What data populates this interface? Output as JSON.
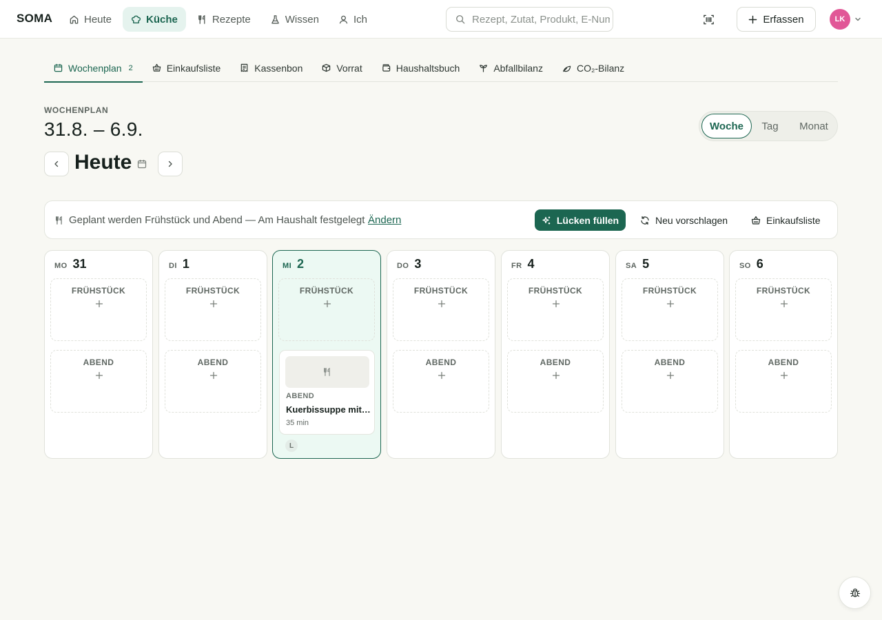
{
  "header": {
    "logo": "SOMA",
    "nav": [
      {
        "label": "Heute",
        "icon": "home-icon"
      },
      {
        "label": "Küche",
        "icon": "chef-hat-icon"
      },
      {
        "label": "Rezepte",
        "icon": "utensils-icon"
      },
      {
        "label": "Wissen",
        "icon": "flask-icon"
      },
      {
        "label": "Ich",
        "icon": "user-icon"
      }
    ],
    "active_nav": "Küche",
    "search_placeholder": "Rezept, Zutat, Produkt, E-Nummer …",
    "add_label": "Erfassen",
    "avatar_initials": "LK"
  },
  "tabs": [
    {
      "label": "Wochenplan",
      "badge": "2",
      "icon": "calendar-icon"
    },
    {
      "label": "Einkaufsliste",
      "icon": "basket-icon"
    },
    {
      "label": "Kassenbon",
      "icon": "receipt-icon"
    },
    {
      "label": "Vorrat",
      "icon": "box-icon"
    },
    {
      "label": "Haushaltsbuch",
      "icon": "wallet-icon"
    },
    {
      "label": "Abfallbilanz",
      "icon": "sprout-icon"
    },
    {
      "label": "CO₂-Bilanz",
      "icon": "leaf-icon"
    }
  ],
  "plan": {
    "eyebrow": "WOCHENPLAN",
    "range": "31.8. – 6.9.",
    "today_title": "Heute",
    "views": [
      "Woche",
      "Tag",
      "Monat"
    ],
    "active_view": "Woche"
  },
  "infobar": {
    "text": "Geplant werden Frühstück und Abend — Am Haushalt festgelegt",
    "link": "Ändern",
    "fill_label": "Lücken füllen",
    "suggest_label": "Neu vorschlagen",
    "shopping_label": "Einkaufsliste"
  },
  "slot_labels": {
    "breakfast": "FRÜHSTÜCK",
    "dinner": "ABEND"
  },
  "days": [
    {
      "abbr": "MO",
      "num": "31"
    },
    {
      "abbr": "DI",
      "num": "1"
    },
    {
      "abbr": "MI",
      "num": "2",
      "today": true
    },
    {
      "abbr": "DO",
      "num": "3"
    },
    {
      "abbr": "FR",
      "num": "4"
    },
    {
      "abbr": "SA",
      "num": "5"
    },
    {
      "abbr": "SO",
      "num": "6"
    }
  ],
  "meal": {
    "type": "ABEND",
    "name": "Kuerbissuppe mit Ingwer",
    "time": "35 min",
    "member": "L"
  },
  "colors": {
    "accent": "#1c6651",
    "accent_bg": "#e5f3ee",
    "avatar": "#e15797"
  }
}
